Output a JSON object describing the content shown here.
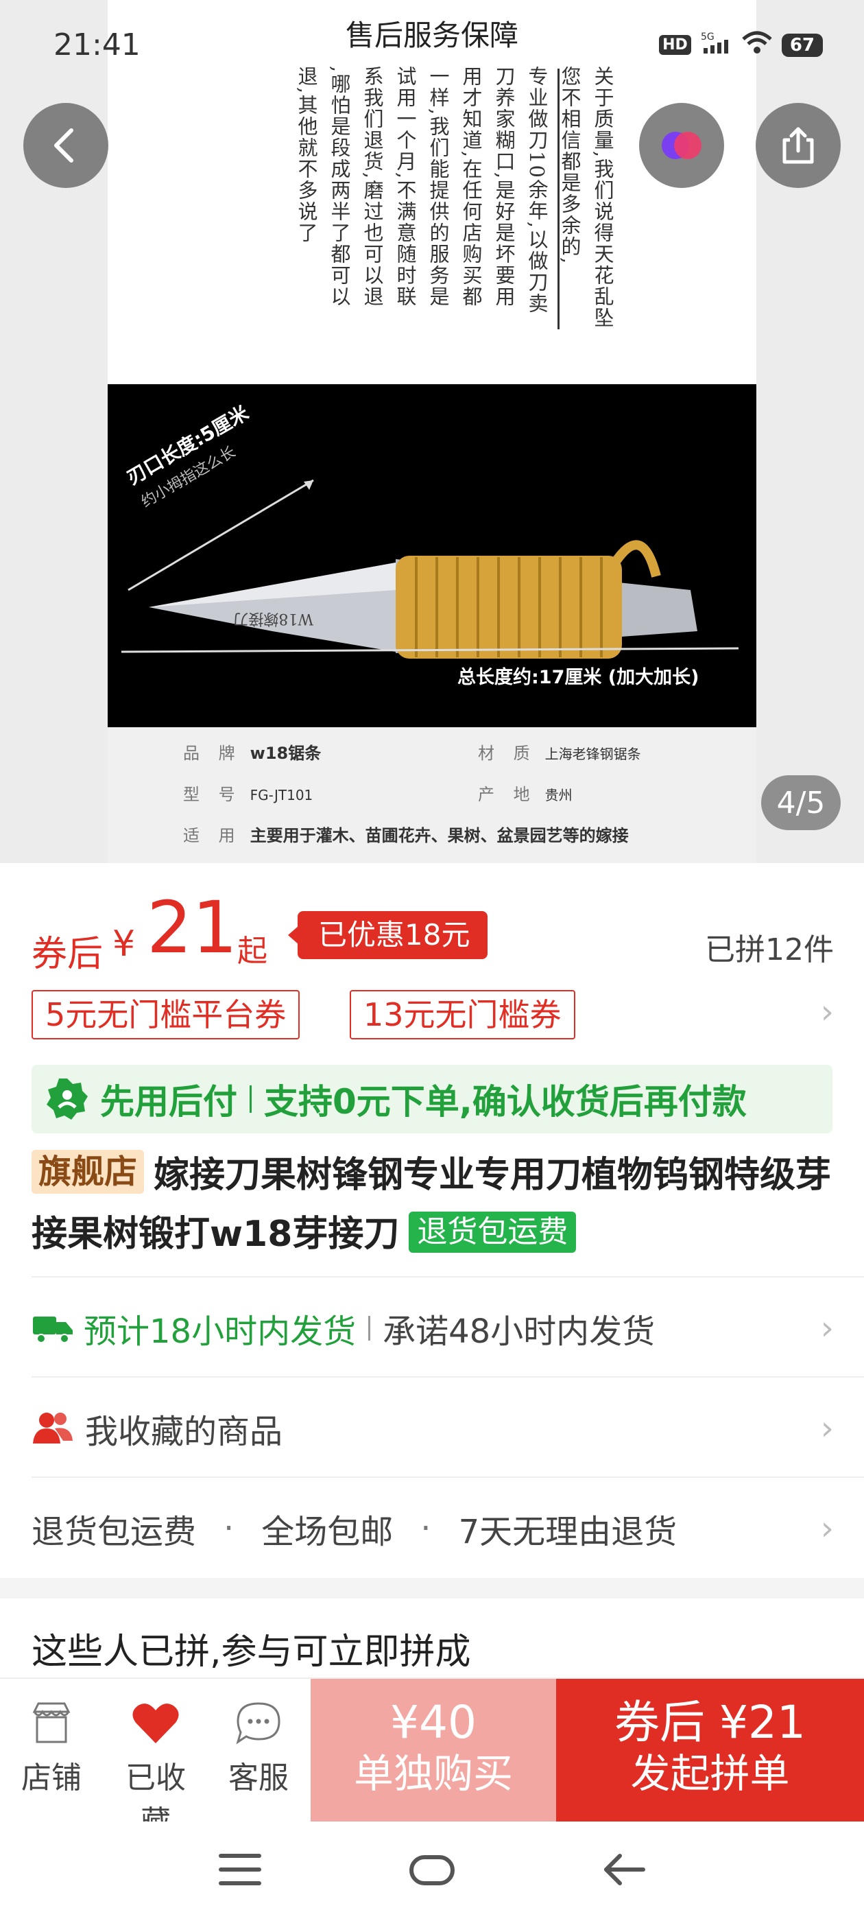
{
  "status_bar": {
    "time": "21:41",
    "hd": "HD",
    "network": "5G",
    "battery": "67"
  },
  "hero": {
    "service_title": "售后服务保障",
    "service_columns": [
      "关于质量,我们说得天花乱坠",
      "您不相信都是多余的,",
      "专业做刀10余年,以做刀卖",
      "刀养家糊口,是好是坏要用",
      "用才知道,在任何店购买都",
      "一样,我们能提供的服务是",
      "试用一个月,不满意随时联",
      "系我们退货,磨过也可以退",
      ",哪怕是段成两半了都可以",
      "退,其他就不多说了"
    ],
    "blade_label": "刃口长度:5厘米",
    "blade_sublabel": "约小拇指这么长",
    "knife_engraving": "W18嫁接刀",
    "total_label": "总长度约:17厘米  (加大加长)",
    "specs": {
      "brand_key": "品 牌",
      "brand_val": "w18锯条",
      "material_key": "材 质",
      "material_val": "上海老锋钢锯条",
      "model_key": "型 号",
      "model_val": "FG-JT101",
      "origin_key": "产 地",
      "origin_val": "贵州",
      "use_key": "适 用",
      "use_val": "主要用于灌木、苗圃花卉、果树、盆景园艺等的嫁接"
    },
    "page_indicator": "4/5"
  },
  "price": {
    "prefix": "券后",
    "currency": "¥",
    "value": "21",
    "suffix": "起",
    "discount": "已优惠18元",
    "group_count": "已拼12件"
  },
  "coupons": [
    "5元无门槛平台券",
    "13元无门槛券"
  ],
  "paylater": {
    "label": "先用后付",
    "desc": "支持0元下单,确认收货后再付款"
  },
  "product": {
    "store_tag": "旗舰店",
    "title": "嫁接刀果树锋钢专业专用刀植物钨钢特级芽接果树锻打w18芽接刀",
    "return_tag": "退货包运费"
  },
  "shipping": {
    "estimate": "预计18小时内发货",
    "promise": "承诺48小时内发货"
  },
  "favorites": {
    "label": "我收藏的商品"
  },
  "guarantees": [
    "退货包运费",
    "全场包邮",
    "7天无理由退货"
  ],
  "joined_section": {
    "title": "这些人已拼,参与可立即拼成"
  },
  "action_bar": {
    "store": "店铺",
    "favorited": "已收藏",
    "service": "客服",
    "alone_price": "¥40",
    "alone_label": "单独购买",
    "group_price": "券后 ¥21",
    "group_label": "发起拼单"
  },
  "colors": {
    "accent": "#e02e24",
    "green": "#22a03b",
    "alone_btn": "#f3a7a2"
  }
}
